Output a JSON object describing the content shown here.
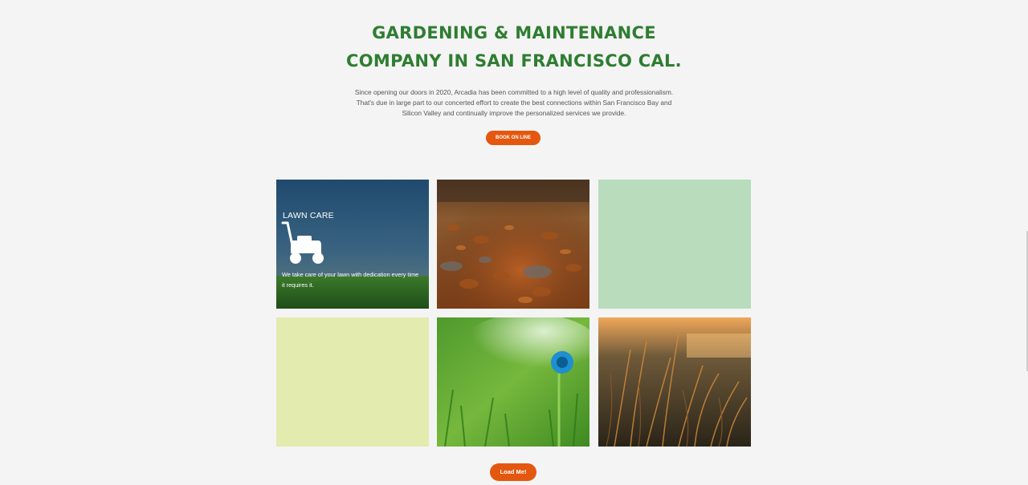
{
  "hero": {
    "title_line1": "GARDENING & MAINTENANCE",
    "title_line2": "COMPANY IN SAN FRANCISCO CAL.",
    "intro": "Since opening our doors in 2020, Arcadia has been committed to a high level of quality and professionalism. That's due in large part to our concerted effort to create the best connections within San Francisco Bay and Silicon Valley and continually improve the personalized services we provide.",
    "book_button": "BOOK ON LINE"
  },
  "tiles": [
    {
      "title": "LAWN CARE",
      "icon": "lawn-mower-icon",
      "text": "We take care of your lawn with dedication every time it requires it."
    },
    {
      "image": "autumn-leaves-path-photo"
    },
    {
      "color": "#b8dcbc"
    },
    {
      "color": "#e4ebae"
    },
    {
      "image": "sprinkler-on-grass-photo"
    },
    {
      "image": "sunset-grass-photo"
    }
  ],
  "load_button": "Load Me!",
  "colors": {
    "accent": "#e4570f",
    "title_green": "#2f7d32",
    "mint_tile": "#b8dcbc",
    "lime_tile": "#e4ebae"
  }
}
